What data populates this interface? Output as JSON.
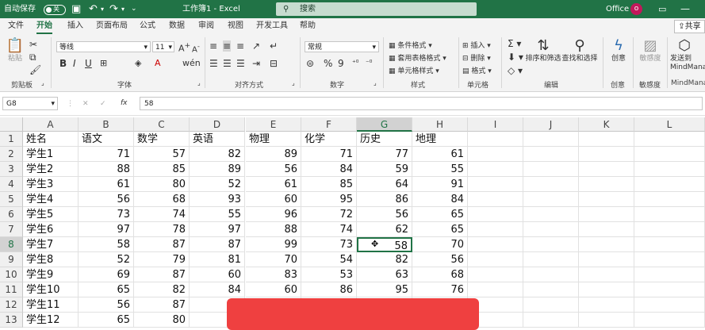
{
  "titlebar": {
    "autosave_label": "自动保存",
    "autosave_state": "关",
    "doc_title": "工作簿1 - Excel",
    "search_placeholder": "搜索",
    "account": "Office",
    "avatar_letter": "o"
  },
  "tabs": [
    "文件",
    "开始",
    "插入",
    "页面布局",
    "公式",
    "数据",
    "审阅",
    "视图",
    "开发工具",
    "帮助"
  ],
  "active_tab": "开始",
  "share_label": "共享",
  "ribbon": {
    "clipboard": {
      "paste": "粘贴",
      "label": "剪贴板"
    },
    "font": {
      "name": "等线",
      "size": "11",
      "label": "字体"
    },
    "alignment": {
      "label": "对齐方式"
    },
    "number": {
      "format": "常规",
      "label": "数字",
      "percent": "%",
      "comma": "9"
    },
    "styles": {
      "cond_format": "条件格式",
      "table_format": "套用表格格式",
      "cell_style": "单元格样式",
      "label": "样式"
    },
    "cells": {
      "insert": "插入",
      "delete": "删除",
      "format": "格式",
      "label": "单元格"
    },
    "editing": {
      "sort_filter": "排序和筛选",
      "find_select": "查找和选择",
      "label": "编辑"
    },
    "ideas": {
      "idea": "创意",
      "label": "创意"
    },
    "sensitivity": {
      "sens": "敏感度",
      "label": "敏感度"
    },
    "mindmanager": {
      "send": "发送到",
      "app": "MindManager",
      "label": "MindManager"
    }
  },
  "formula_bar": {
    "name_box": "G8",
    "fx": "fx",
    "cancel": "✕",
    "enter": "✓",
    "value": "58"
  },
  "columns": [
    "A",
    "B",
    "C",
    "D",
    "E",
    "F",
    "G",
    "H",
    "I",
    "J",
    "K",
    "L"
  ],
  "selected_column": "G",
  "selected_row": "8",
  "rows": [
    {
      "n": "1",
      "cells": [
        "姓名",
        "语文",
        "数学",
        "英语",
        "物理",
        "化学",
        "历史",
        "地理"
      ]
    },
    {
      "n": "2",
      "cells": [
        "学生1",
        "71",
        "57",
        "82",
        "89",
        "71",
        "77",
        "61"
      ]
    },
    {
      "n": "3",
      "cells": [
        "学生2",
        "88",
        "85",
        "89",
        "56",
        "84",
        "59",
        "55"
      ]
    },
    {
      "n": "4",
      "cells": [
        "学生3",
        "61",
        "80",
        "52",
        "61",
        "85",
        "64",
        "91"
      ]
    },
    {
      "n": "5",
      "cells": [
        "学生4",
        "56",
        "68",
        "93",
        "60",
        "95",
        "86",
        "84"
      ]
    },
    {
      "n": "6",
      "cells": [
        "学生5",
        "73",
        "74",
        "55",
        "96",
        "72",
        "56",
        "65"
      ]
    },
    {
      "n": "7",
      "cells": [
        "学生6",
        "97",
        "78",
        "97",
        "88",
        "74",
        "62",
        "65"
      ]
    },
    {
      "n": "8",
      "cells": [
        "学生7",
        "58",
        "87",
        "87",
        "99",
        "73",
        "58",
        "70"
      ]
    },
    {
      "n": "9",
      "cells": [
        "学生8",
        "52",
        "79",
        "81",
        "70",
        "54",
        "82",
        "56"
      ]
    },
    {
      "n": "10",
      "cells": [
        "学生9",
        "69",
        "87",
        "60",
        "83",
        "53",
        "63",
        "68"
      ]
    },
    {
      "n": "11",
      "cells": [
        "学生10",
        "65",
        "82",
        "84",
        "60",
        "86",
        "95",
        "76"
      ]
    },
    {
      "n": "12",
      "cells": [
        "学生11",
        "56",
        "87",
        "",
        "",
        "",
        "",
        ""
      ]
    },
    {
      "n": "13",
      "cells": [
        "学生12",
        "65",
        "80",
        "",
        "",
        "",
        "",
        ""
      ]
    }
  ],
  "colors": {
    "excel_green": "#217346",
    "overlay_red": "#ef4040"
  }
}
